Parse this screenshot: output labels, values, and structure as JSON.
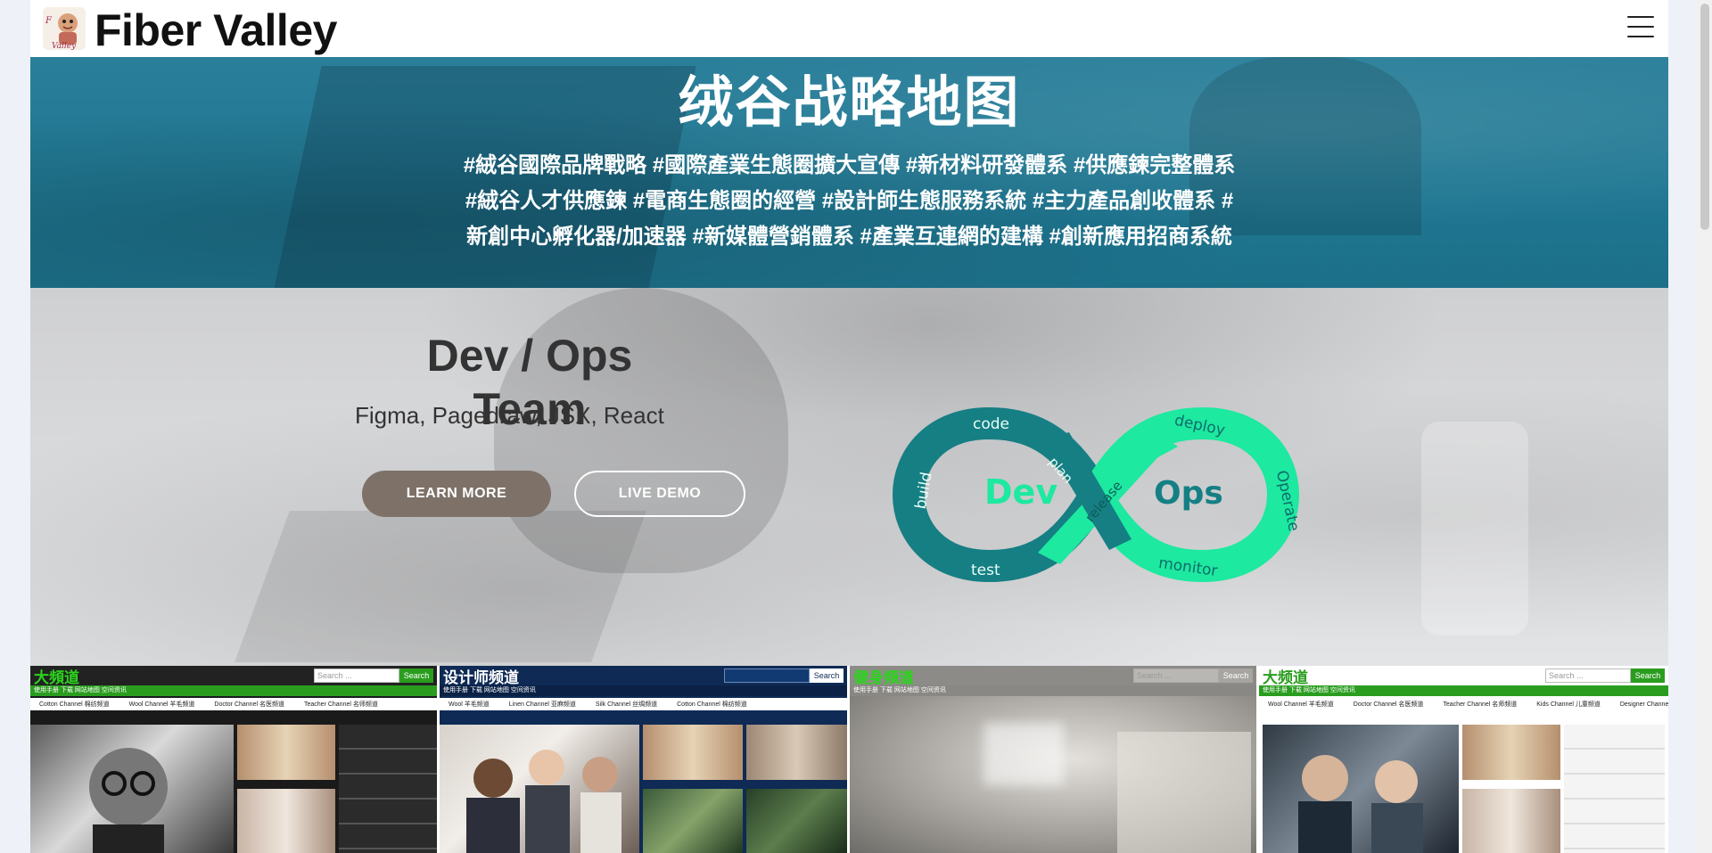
{
  "header": {
    "brand": "Fiber Valley",
    "logo_icon": "cartoon-character-logo",
    "menu_icon": "hamburger-icon"
  },
  "hero": {
    "title": "绒谷战略地图",
    "tags_line1": "#絨谷國際品牌戰略 #國際產業生態圈擴大宣傳 #新材料研發體系 #供應鍊完整體系",
    "tags_line2": "#絨谷人才供應鍊 #電商生態圈的經營 #設計師生態服務系統 #主力產品創收體系 #",
    "tags_line3": "新創中心孵化器/加速器 #新媒體營銷體系 #產業互連網的建構 #創新應用招商系統"
  },
  "devops": {
    "title": "Dev / Ops Team",
    "stack": "Figma, Pagedraw, JSX, React",
    "learn_more": "LEARN MORE",
    "live_demo": "LIVE DEMO",
    "graphic": {
      "dev": "Dev",
      "ops": "Ops",
      "code": "code",
      "build": "build",
      "test": "test",
      "plan": "plan",
      "release": "release",
      "deploy": "deploy",
      "operate": "Operate",
      "monitor": "monitor"
    }
  },
  "thumbnails": [
    {
      "title": "大頻道",
      "search_placeholder": "Search ...",
      "search_button": "Search",
      "nav": "使用手册  下载  网站地图  空间资讯",
      "channels": [
        "Cotton Channel 棉纺频道",
        "Wool Channel 羊毛频道",
        "Doctor Channel 名医频道",
        "Teacher Channel 名师频道"
      ],
      "colors": {
        "bar": "#2a9d1f",
        "title": "#2bd41c"
      }
    },
    {
      "title": "设计师频道",
      "search_placeholder": "",
      "search_button": "Search",
      "nav": "使用手册  下载  网站地图  空间资讯",
      "channels": [
        "Wool 羊毛频道",
        "Linen Channel 亚麻频道",
        "Silk Channel 丝绸频道",
        "Cotton Channel 棉纺频道"
      ],
      "colors": {
        "bar": "#0e2a55",
        "title": "#ffffff"
      }
    },
    {
      "title": "健身頻道",
      "search_placeholder": "Search ...",
      "search_button": "Search",
      "nav": "使用手册  下载  网站地图  空间资讯",
      "channels": [],
      "colors": {
        "bar": "#8d8b87",
        "title": "#2bd41c"
      }
    },
    {
      "title": "大频道",
      "search_placeholder": "Search ...",
      "search_button": "Search",
      "nav": "使用手册  下载  网站地图  空间资讯",
      "channels": [
        "Wool Channel 羊毛频道",
        "Doctor Channel 名医频道",
        "Teacher Channel 名师频道",
        "Kids Channel 儿童频道",
        "Designer Channel 设计"
      ],
      "colors": {
        "bar": "#2a9d1f",
        "title": "#2a9d1f"
      }
    }
  ],
  "colors": {
    "hero_bg": "#1f7792",
    "learn_btn": "#7d7168",
    "devops_dark": "#157f84",
    "devops_light": "#1de9a0"
  }
}
